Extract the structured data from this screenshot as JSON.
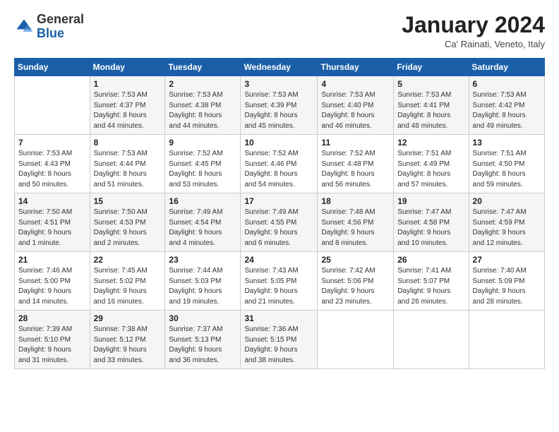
{
  "logo": {
    "general": "General",
    "blue": "Blue"
  },
  "header": {
    "title": "January 2024",
    "subtitle": "Ca' Rainati, Veneto, Italy"
  },
  "weekdays": [
    "Sunday",
    "Monday",
    "Tuesday",
    "Wednesday",
    "Thursday",
    "Friday",
    "Saturday"
  ],
  "weeks": [
    [
      {
        "day": "",
        "info": ""
      },
      {
        "day": "1",
        "info": "Sunrise: 7:53 AM\nSunset: 4:37 PM\nDaylight: 8 hours\nand 44 minutes."
      },
      {
        "day": "2",
        "info": "Sunrise: 7:53 AM\nSunset: 4:38 PM\nDaylight: 8 hours\nand 44 minutes."
      },
      {
        "day": "3",
        "info": "Sunrise: 7:53 AM\nSunset: 4:39 PM\nDaylight: 8 hours\nand 45 minutes."
      },
      {
        "day": "4",
        "info": "Sunrise: 7:53 AM\nSunset: 4:40 PM\nDaylight: 8 hours\nand 46 minutes."
      },
      {
        "day": "5",
        "info": "Sunrise: 7:53 AM\nSunset: 4:41 PM\nDaylight: 8 hours\nand 48 minutes."
      },
      {
        "day": "6",
        "info": "Sunrise: 7:53 AM\nSunset: 4:42 PM\nDaylight: 8 hours\nand 49 minutes."
      }
    ],
    [
      {
        "day": "7",
        "info": "Sunrise: 7:53 AM\nSunset: 4:43 PM\nDaylight: 8 hours\nand 50 minutes."
      },
      {
        "day": "8",
        "info": "Sunrise: 7:53 AM\nSunset: 4:44 PM\nDaylight: 8 hours\nand 51 minutes."
      },
      {
        "day": "9",
        "info": "Sunrise: 7:52 AM\nSunset: 4:45 PM\nDaylight: 8 hours\nand 53 minutes."
      },
      {
        "day": "10",
        "info": "Sunrise: 7:52 AM\nSunset: 4:46 PM\nDaylight: 8 hours\nand 54 minutes."
      },
      {
        "day": "11",
        "info": "Sunrise: 7:52 AM\nSunset: 4:48 PM\nDaylight: 8 hours\nand 56 minutes."
      },
      {
        "day": "12",
        "info": "Sunrise: 7:51 AM\nSunset: 4:49 PM\nDaylight: 8 hours\nand 57 minutes."
      },
      {
        "day": "13",
        "info": "Sunrise: 7:51 AM\nSunset: 4:50 PM\nDaylight: 8 hours\nand 59 minutes."
      }
    ],
    [
      {
        "day": "14",
        "info": "Sunrise: 7:50 AM\nSunset: 4:51 PM\nDaylight: 9 hours\nand 1 minute."
      },
      {
        "day": "15",
        "info": "Sunrise: 7:50 AM\nSunset: 4:53 PM\nDaylight: 9 hours\nand 2 minutes."
      },
      {
        "day": "16",
        "info": "Sunrise: 7:49 AM\nSunset: 4:54 PM\nDaylight: 9 hours\nand 4 minutes."
      },
      {
        "day": "17",
        "info": "Sunrise: 7:49 AM\nSunset: 4:55 PM\nDaylight: 9 hours\nand 6 minutes."
      },
      {
        "day": "18",
        "info": "Sunrise: 7:48 AM\nSunset: 4:56 PM\nDaylight: 9 hours\nand 8 minutes."
      },
      {
        "day": "19",
        "info": "Sunrise: 7:47 AM\nSunset: 4:58 PM\nDaylight: 9 hours\nand 10 minutes."
      },
      {
        "day": "20",
        "info": "Sunrise: 7:47 AM\nSunset: 4:59 PM\nDaylight: 9 hours\nand 12 minutes."
      }
    ],
    [
      {
        "day": "21",
        "info": "Sunrise: 7:46 AM\nSunset: 5:00 PM\nDaylight: 9 hours\nand 14 minutes."
      },
      {
        "day": "22",
        "info": "Sunrise: 7:45 AM\nSunset: 5:02 PM\nDaylight: 9 hours\nand 16 minutes."
      },
      {
        "day": "23",
        "info": "Sunrise: 7:44 AM\nSunset: 5:03 PM\nDaylight: 9 hours\nand 19 minutes."
      },
      {
        "day": "24",
        "info": "Sunrise: 7:43 AM\nSunset: 5:05 PM\nDaylight: 9 hours\nand 21 minutes."
      },
      {
        "day": "25",
        "info": "Sunrise: 7:42 AM\nSunset: 5:06 PM\nDaylight: 9 hours\nand 23 minutes."
      },
      {
        "day": "26",
        "info": "Sunrise: 7:41 AM\nSunset: 5:07 PM\nDaylight: 9 hours\nand 26 minutes."
      },
      {
        "day": "27",
        "info": "Sunrise: 7:40 AM\nSunset: 5:09 PM\nDaylight: 9 hours\nand 28 minutes."
      }
    ],
    [
      {
        "day": "28",
        "info": "Sunrise: 7:39 AM\nSunset: 5:10 PM\nDaylight: 9 hours\nand 31 minutes."
      },
      {
        "day": "29",
        "info": "Sunrise: 7:38 AM\nSunset: 5:12 PM\nDaylight: 9 hours\nand 33 minutes."
      },
      {
        "day": "30",
        "info": "Sunrise: 7:37 AM\nSunset: 5:13 PM\nDaylight: 9 hours\nand 36 minutes."
      },
      {
        "day": "31",
        "info": "Sunrise: 7:36 AM\nSunset: 5:15 PM\nDaylight: 9 hours\nand 38 minutes."
      },
      {
        "day": "",
        "info": ""
      },
      {
        "day": "",
        "info": ""
      },
      {
        "day": "",
        "info": ""
      }
    ]
  ]
}
